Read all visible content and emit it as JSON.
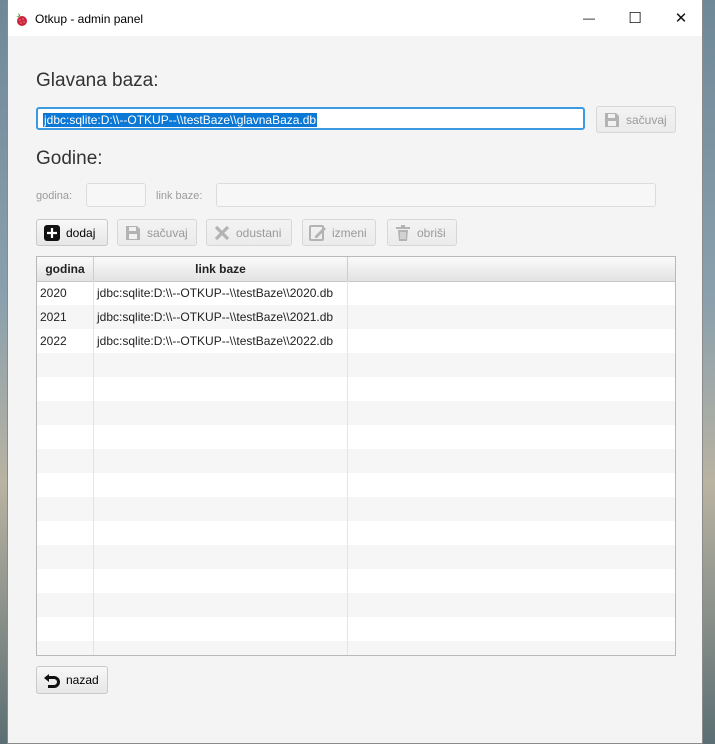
{
  "window": {
    "title": "Otkup - admin panel",
    "controls": {
      "minimize": "—",
      "maximize": "☐",
      "close": "✕"
    }
  },
  "main_db": {
    "heading": "Glavana baza:",
    "value": "jdbc:sqlite:D:\\\\--OTKUP--\\\\testBaze\\\\glavnaBaza.db",
    "save_label": "sačuvaj"
  },
  "years": {
    "heading": "Godine:",
    "year_label": "godina:",
    "link_label": "link baze:",
    "year_value": "",
    "link_value": ""
  },
  "toolbar": {
    "add_label": "dodaj",
    "save_label": "sačuvaj",
    "cancel_label": "odustani",
    "edit_label": "izmeni",
    "delete_label": "obriši"
  },
  "table": {
    "columns": [
      "godina",
      "link baze",
      ""
    ],
    "rows": [
      [
        "2020",
        "jdbc:sqlite:D:\\\\--OTKUP--\\\\testBaze\\\\2020.db"
      ],
      [
        "2021",
        "jdbc:sqlite:D:\\\\--OTKUP--\\\\testBaze\\\\2021.db"
      ],
      [
        "2022",
        "jdbc:sqlite:D:\\\\--OTKUP--\\\\testBaze\\\\2022.db"
      ]
    ]
  },
  "footer": {
    "back_label": "nazad"
  },
  "colors": {
    "accent": "#0b78d6",
    "focus_border": "#3c9ae0"
  }
}
